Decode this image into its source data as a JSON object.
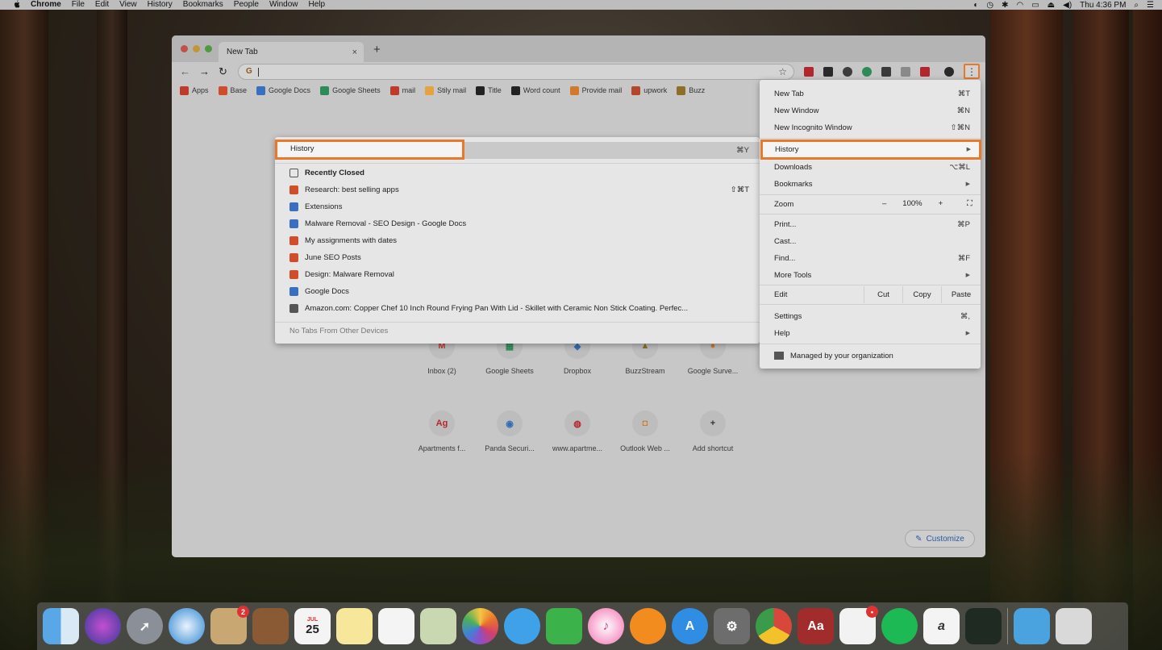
{
  "menubar": {
    "apple": "",
    "items": [
      "Chrome",
      "File",
      "Edit",
      "View",
      "History",
      "Bookmarks",
      "People",
      "Window",
      "Help"
    ],
    "clock": "Thu 4:36 PM"
  },
  "tab": {
    "title": "New Tab",
    "close": "×"
  },
  "new_tab_button": "+",
  "omnibox": {
    "g": "G",
    "star": "☆"
  },
  "kebab": "⋮",
  "bookmarks": [
    {
      "label": "Apps",
      "color": "#c0392b"
    },
    {
      "label": "Base",
      "color": "#d14d2a"
    },
    {
      "label": "Google Docs",
      "color": "#3a6fbf"
    },
    {
      "label": "Google Sheets",
      "color": "#2e8b57"
    },
    {
      "label": "mail",
      "color": "#c0392b"
    },
    {
      "label": "Stily mail",
      "color": "#e6a23c"
    },
    {
      "label": "Title",
      "color": "#222222"
    },
    {
      "label": "Word count",
      "color": "#222222"
    },
    {
      "label": "Provide mail",
      "color": "#d27a2a"
    },
    {
      "label": "upwork",
      "color": "#b5462c"
    },
    {
      "label": "Buzz",
      "color": "#8d6e2a"
    }
  ],
  "shortcuts_row1": [
    {
      "label": "Inbox (2)",
      "glyph": "M",
      "color": "#c0392b"
    },
    {
      "label": "Google Sheets",
      "glyph": "▦",
      "color": "#2e8b57"
    },
    {
      "label": "Dropbox",
      "glyph": "◆",
      "color": "#2f6db5"
    },
    {
      "label": "BuzzStream",
      "glyph": "▲",
      "color": "#8d6e2a"
    },
    {
      "label": "Google Surve...",
      "glyph": "●",
      "color": "#c97b2a"
    }
  ],
  "shortcuts_row2": [
    {
      "label": "Apartments f...",
      "glyph": "Ag",
      "color": "#b5262c"
    },
    {
      "label": "Panda Securi...",
      "glyph": "◉",
      "color": "#2f6db5"
    },
    {
      "label": "www.apartme...",
      "glyph": "◍",
      "color": "#b5262c"
    },
    {
      "label": "Outlook Web ...",
      "glyph": "◘",
      "color": "#c97b2a"
    },
    {
      "label": "Add shortcut",
      "glyph": "+",
      "color": "#333333"
    }
  ],
  "customize": {
    "icon": "✎",
    "label": "Customize"
  },
  "main_menu": {
    "new_tab": {
      "label": "New Tab",
      "shortcut": "⌘T"
    },
    "new_window": {
      "label": "New Window",
      "shortcut": "⌘N"
    },
    "new_incognito": {
      "label": "New Incognito Window",
      "shortcut": "⇧⌘N"
    },
    "history": {
      "label": "History",
      "arrow": "▶"
    },
    "downloads": {
      "label": "Downloads",
      "shortcut": "⌥⌘L"
    },
    "bookmarks": {
      "label": "Bookmarks",
      "arrow": "▶"
    },
    "zoom": {
      "label": "Zoom",
      "minus": "–",
      "value": "100%",
      "plus": "+",
      "fullscreen": "⛶"
    },
    "print": {
      "label": "Print...",
      "shortcut": "⌘P"
    },
    "cast": {
      "label": "Cast..."
    },
    "find": {
      "label": "Find...",
      "shortcut": "⌘F"
    },
    "more_tools": {
      "label": "More Tools",
      "arrow": "▶"
    },
    "edit": {
      "label": "Edit",
      "cut": "Cut",
      "copy": "Copy",
      "paste": "Paste"
    },
    "settings": {
      "label": "Settings",
      "shortcut": "⌘,"
    },
    "help": {
      "label": "Help",
      "arrow": "▶"
    },
    "managed": {
      "label": "Managed by your organization"
    }
  },
  "history_menu": {
    "history": {
      "label": "History",
      "shortcut": "⌘Y"
    },
    "recently_closed": "Recently Closed",
    "items": [
      {
        "label": "Research: best selling apps",
        "shortcut": "⇧⌘T",
        "color": "#d14d2a"
      },
      {
        "label": "Extensions",
        "shortcut": "",
        "color": "#3a6fbf"
      },
      {
        "label": "Malware Removal - SEO Design - Google Docs",
        "shortcut": "",
        "color": "#3a6fbf"
      },
      {
        "label": "My assignments with dates",
        "shortcut": "",
        "color": "#d14d2a"
      },
      {
        "label": "June SEO Posts",
        "shortcut": "",
        "color": "#d14d2a"
      },
      {
        "label": "Design: Malware Removal",
        "shortcut": "",
        "color": "#d14d2a"
      },
      {
        "label": "Google Docs",
        "shortcut": "",
        "color": "#3a6fbf"
      },
      {
        "label": "Amazon.com: Copper Chef 10 Inch Round Frying Pan With Lid - Skillet with Ceramic Non Stick Coating. Perfec...",
        "shortcut": "",
        "color": "#555555"
      }
    ],
    "no_tabs": "No Tabs From Other Devices"
  },
  "dock": {
    "calendar_month": "JUL",
    "calendar_day": "25",
    "mail_badge": "2",
    "slack_badge": "•"
  }
}
